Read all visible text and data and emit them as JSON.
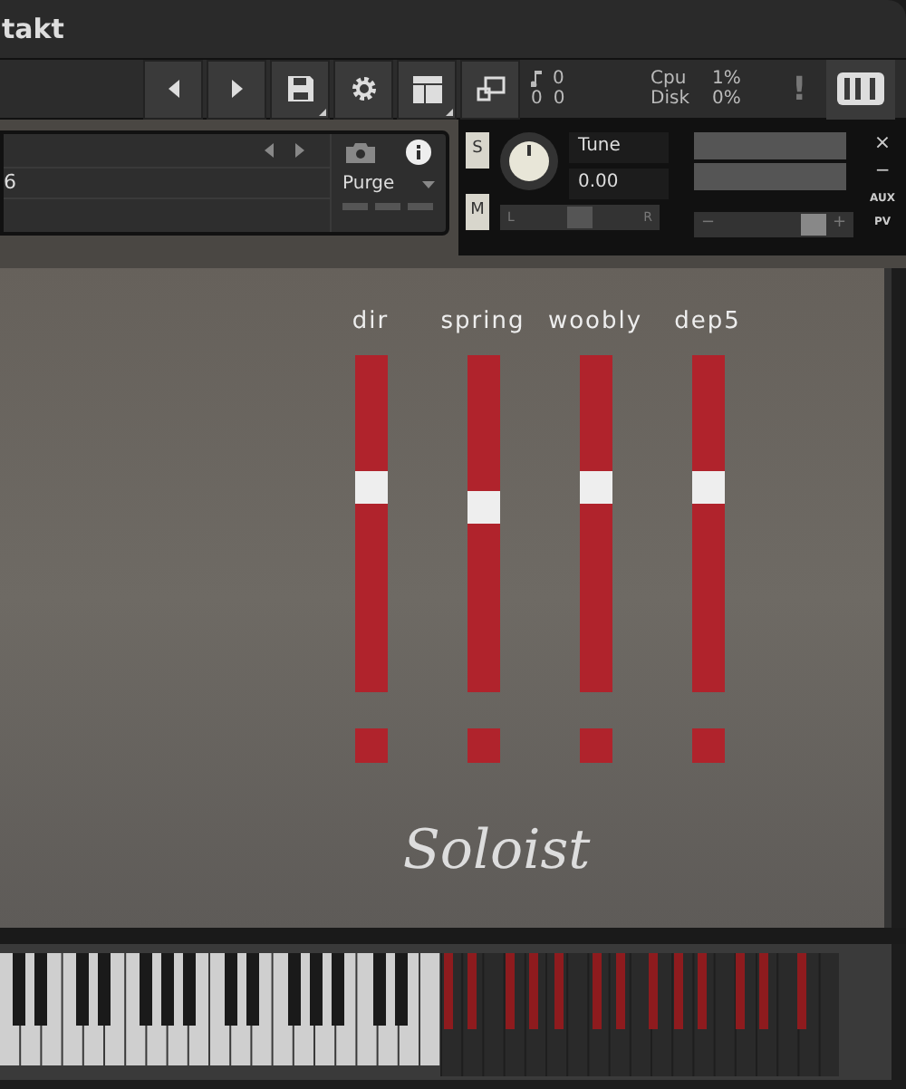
{
  "window": {
    "title": "takt"
  },
  "toolbar": {
    "voices": "0",
    "memory": [
      "0",
      "0"
    ],
    "cpu_label": "Cpu",
    "cpu": "1%",
    "disk_label": "Disk",
    "disk": "0%",
    "warning": "!"
  },
  "instrument": {
    "value": "6",
    "purge": "Purge",
    "solo": "S",
    "mute": "M",
    "tune_label": "Tune",
    "tune_value": "0.00",
    "pan": {
      "left": "L",
      "right": "R",
      "level": 0.5
    },
    "volume": {
      "minus": "−",
      "plus": "+",
      "level": 0.8
    },
    "close": "×",
    "minimize": "−",
    "aux": "AUX",
    "pv": "PV"
  },
  "sliders": [
    {
      "name": "dir",
      "level": 0.61
    },
    {
      "name": "spring",
      "level": 0.55
    },
    {
      "name": "woobly",
      "level": 0.61
    },
    {
      "name": "dep5",
      "level": 0.61
    }
  ],
  "logo": "Soloist"
}
